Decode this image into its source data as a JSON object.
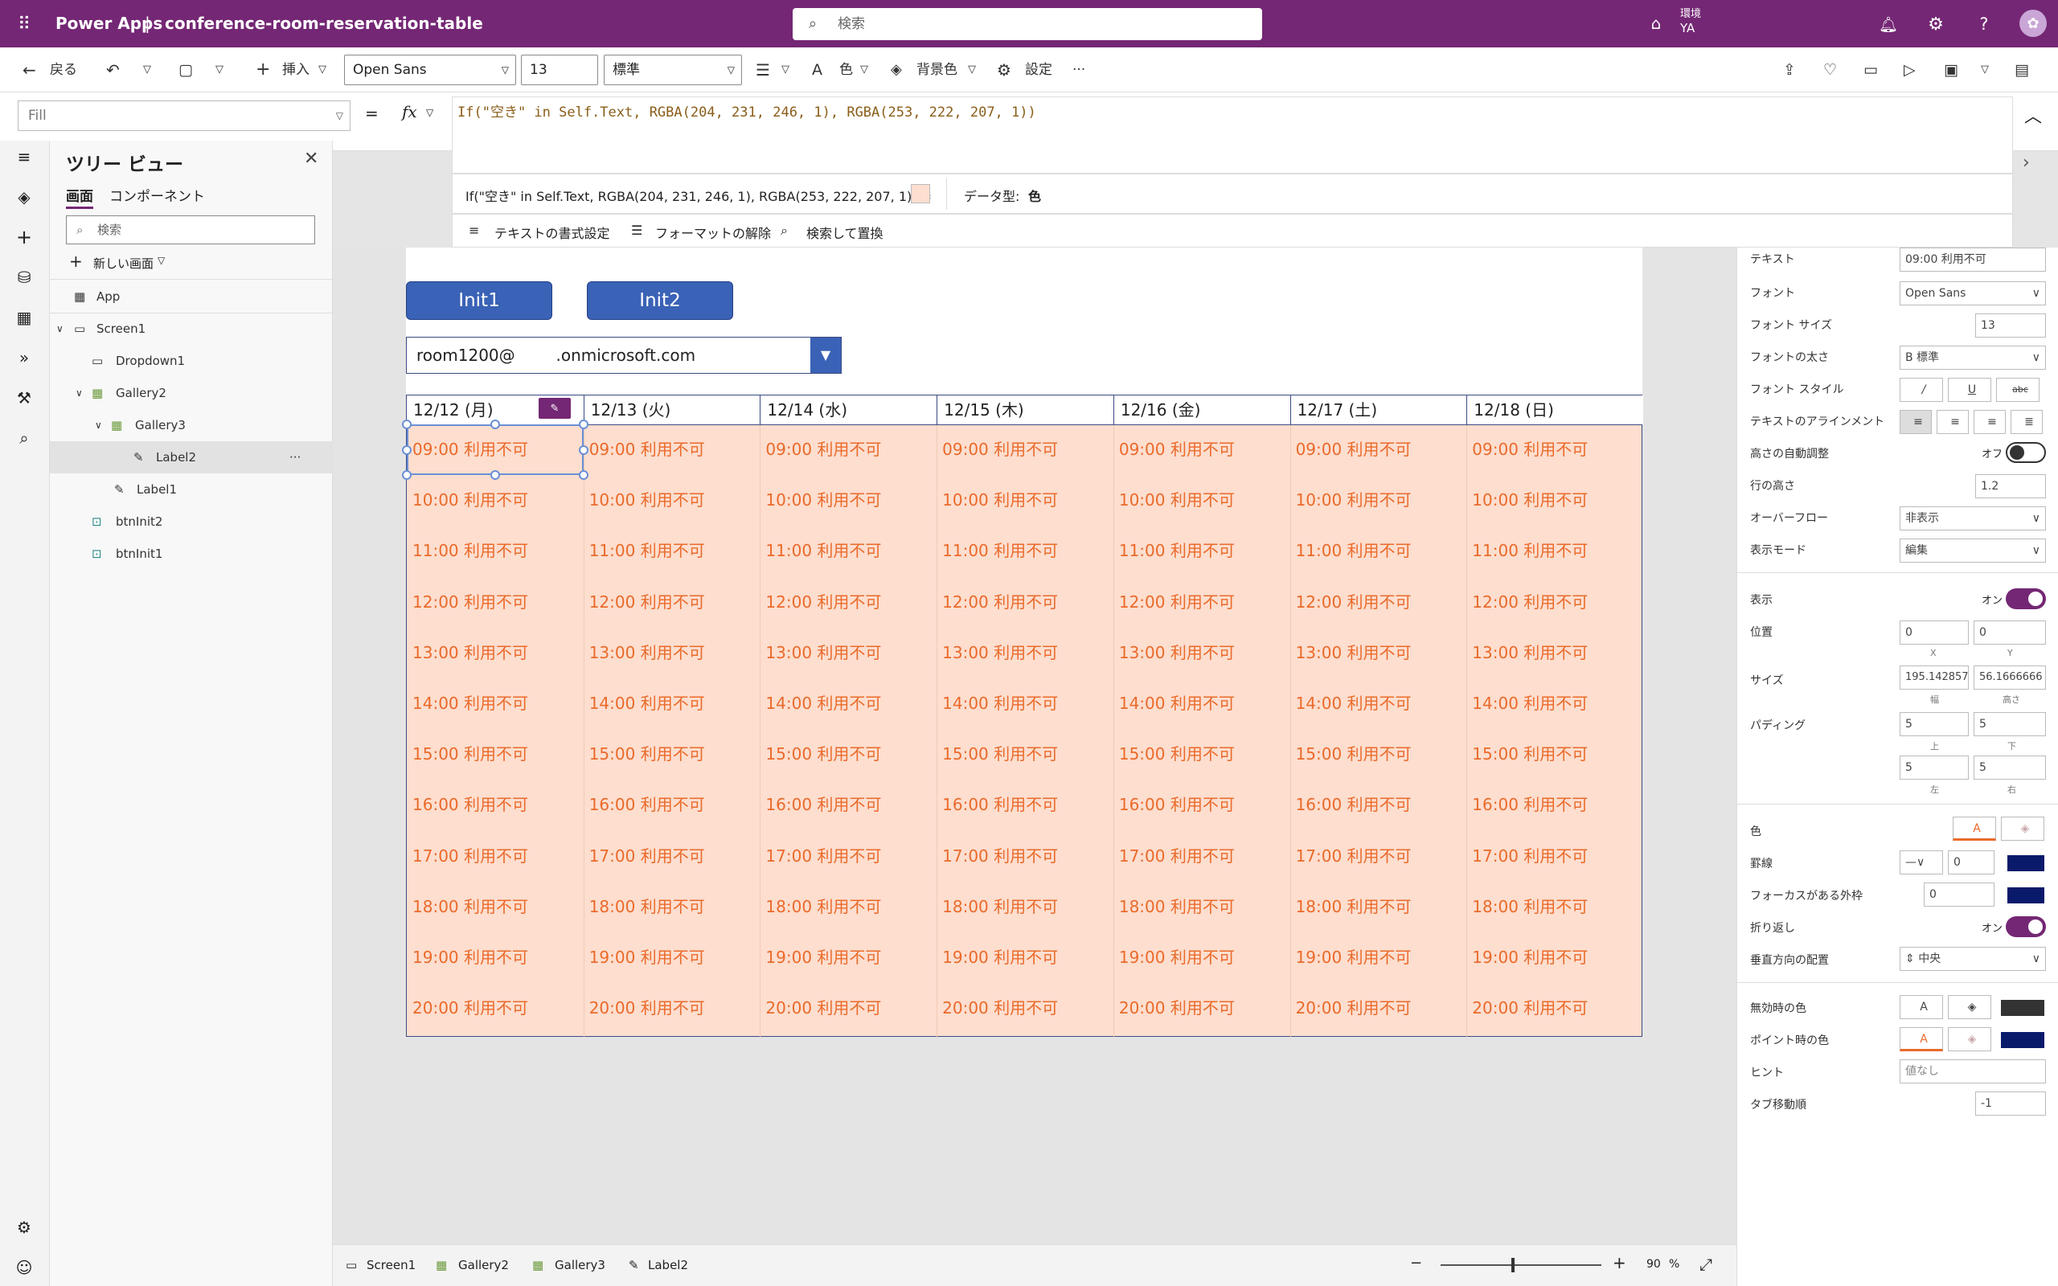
{
  "app": {
    "brand": "Power Apps",
    "separator": "|",
    "file_name": "conference-room-reservation-table",
    "search_placeholder": "検索",
    "env_label": "環境",
    "env_user": "YA"
  },
  "toolbar": {
    "back": "戻る",
    "insert": "挿入",
    "font": "Open Sans",
    "font_size": "13",
    "font_weight": "標準",
    "color": "色",
    "background": "背景色",
    "settings": "設定",
    "more": "···"
  },
  "formula": {
    "property": "Fill",
    "equals": "=",
    "fx": "fx",
    "code": "If(\"空き\" in Self.Text, RGBA(204, 231, 246, 1), RGBA(253, 222, 207, 1))",
    "result_expr": "If(\"空き\" in Self.Text, RGBA(204, 231, 246, 1), RGBA(253, 222, 207, 1))  =",
    "data_type_label": "データ型:",
    "data_type_value": "色",
    "tools": [
      "テキストの書式設定",
      "フォーマットの解除",
      "検索して置換"
    ]
  },
  "tree": {
    "title": "ツリー ビュー",
    "tabs": [
      "画面",
      "コンポーネント"
    ],
    "search_placeholder": "検索",
    "new_screen": "新しい画面",
    "more": "···",
    "items": [
      {
        "label": "App",
        "icon": "app-icon"
      },
      {
        "label": "Screen1",
        "icon": "screen-icon"
      },
      {
        "label": "Dropdown1",
        "icon": "dropdown-icon"
      },
      {
        "label": "Gallery2",
        "icon": "gallery-icon"
      },
      {
        "label": "Gallery3",
        "icon": "gallery-icon"
      },
      {
        "label": "Label2",
        "icon": "label-icon"
      },
      {
        "label": "Label1",
        "icon": "label-icon"
      },
      {
        "label": "btnInit2",
        "icon": "button-icon"
      },
      {
        "label": "btnInit1",
        "icon": "button-icon"
      }
    ]
  },
  "canvas": {
    "init1": "Init1",
    "init2": "Init2",
    "dropdown_value": "room1200@        .onmicrosoft.com",
    "days": [
      "12/12 (月)",
      "12/13 (火)",
      "12/14 (水)",
      "12/15 (木)",
      "12/16 (金)",
      "12/17 (土)",
      "12/18 (日)"
    ],
    "slots": [
      "09:00 利用不可",
      "10:00 利用不可",
      "11:00 利用不可",
      "12:00 利用不可",
      "13:00 利用不可",
      "14:00 利用不可",
      "15:00 利用不可",
      "16:00 利用不可",
      "17:00 利用不可",
      "18:00 利用不可",
      "19:00 利用不可",
      "20:00 利用不可"
    ],
    "cell_color": "#fddecf",
    "text_color": "#ea6a2a"
  },
  "props": {
    "text_label": "テキスト",
    "text_value": "09:00 利用不可",
    "font_label": "フォント",
    "font_value": "Open Sans",
    "size_label": "フォント サイズ",
    "size_value": "13",
    "weight_label": "フォントの太さ",
    "weight_value": "B  標準",
    "style_label": "フォント スタイル",
    "style_italic": "/",
    "style_underline": "U",
    "style_strike": "abc",
    "align_label": "テキストのアラインメント",
    "autoheight_label": "高さの自動調整",
    "autoheight_value": "オフ",
    "lineheight_label": "行の高さ",
    "lineheight_value": "1.2",
    "overflow_label": "オーバーフロー",
    "overflow_value": "非表示",
    "mode_label": "表示モード",
    "mode_value": "編集",
    "visible_label": "表示",
    "visible_value": "オン",
    "pos_label": "位置",
    "pos_x": "0",
    "pos_y": "0",
    "x": "X",
    "y": "Y",
    "size2_label": "サイズ",
    "width_value": "195.142857",
    "height_value": "56.1666666",
    "width_sub": "幅",
    "height_sub": "高さ",
    "padding_label": "パディング",
    "pad_top": "5",
    "pad_bottom": "5",
    "pad_left": "5",
    "pad_right": "5",
    "top_sub": "上",
    "bottom_sub": "下",
    "left_sub": "左",
    "right_sub": "右",
    "color_label": "色",
    "border_label": "罫線",
    "border_value": "0",
    "focus_label": "フォーカスがある外枠",
    "focus_value": "0",
    "wrap_label": "折り返し",
    "wrap_value": "オン",
    "valign_label": "垂直方向の配置",
    "valign_value": "中央",
    "disabled_label": "無効時の色",
    "hover_label": "ポイント時の色",
    "hint_label": "ヒント",
    "hint_value": "値なし",
    "tab_label": "タブ移動順",
    "tab_value": "-1"
  },
  "status": {
    "crumbs": [
      "Screen1",
      "Gallery2",
      "Gallery3",
      "Label2"
    ],
    "zoom": "90",
    "percent": "%",
    "minus": "−",
    "plus": "+"
  },
  "colors": {
    "brand": "#742774",
    "accent": "#3a62b6",
    "cell": "#fddecf"
  }
}
